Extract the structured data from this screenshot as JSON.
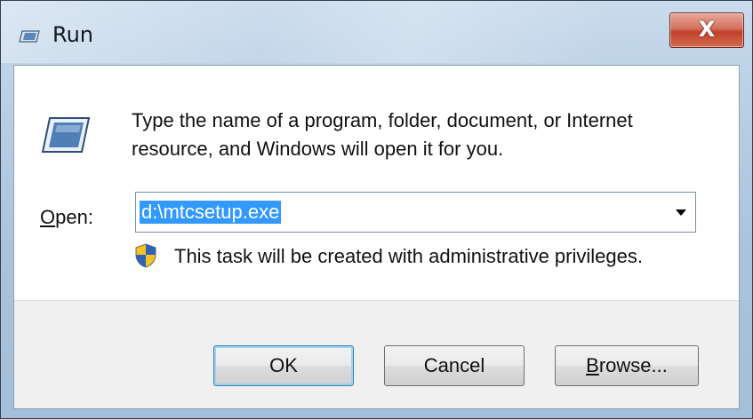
{
  "window": {
    "title": "Run",
    "close_label": "X"
  },
  "body": {
    "description": "Type the name of a program, folder, document, or Internet resource, and Windows will open it for you.",
    "open_label_access": "O",
    "open_label_rest": "pen:",
    "open_value": "d:\\mtcsetup.exe",
    "admin_note": "This task will be created with administrative privileges."
  },
  "buttons": {
    "ok": "OK",
    "cancel": "Cancel",
    "browse_access": "B",
    "browse_rest": "rowse..."
  },
  "icons": {
    "title": "run-icon",
    "main": "run-icon",
    "shield": "uac-shield-icon",
    "dropdown": "chevron-down-icon"
  },
  "colors": {
    "selection": "#3399ff",
    "close_button": "#c0412a",
    "default_button_border": "#3c7fb1"
  }
}
